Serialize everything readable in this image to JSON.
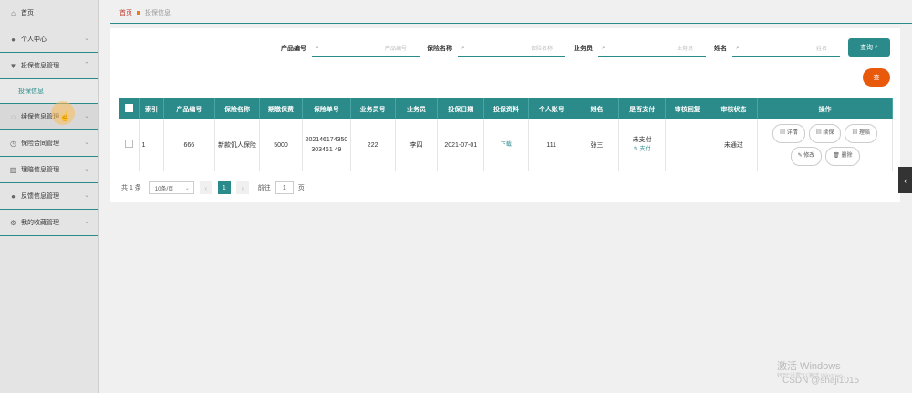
{
  "sidebar": {
    "items": [
      {
        "label": "首页",
        "icon": "home-icon",
        "has_chevron": false
      },
      {
        "label": "个人中心",
        "icon": "user-icon",
        "has_chevron": true
      },
      {
        "label": "投保信息管理",
        "icon": "filter-icon",
        "has_chevron": true,
        "expanded": true
      }
    ],
    "sub_item": "投保信息",
    "items_after": [
      {
        "label": "续保信息管理",
        "icon": "chat-icon",
        "has_chevron": true
      },
      {
        "label": "保险合同管理",
        "icon": "clock-icon",
        "has_chevron": true
      },
      {
        "label": "理赔信息管理",
        "icon": "bank-icon",
        "has_chevron": true
      },
      {
        "label": "反馈信息管理",
        "icon": "user-icon",
        "has_chevron": true
      },
      {
        "label": "我的收藏管理",
        "icon": "gear-icon",
        "has_chevron": true
      }
    ]
  },
  "breadcrumb": {
    "home": "首页",
    "current": "投保信息"
  },
  "search": {
    "product_label": "产品编号",
    "product_placeholder": "产品编号",
    "insurance_label": "保险名称",
    "insurance_placeholder": "保险名称",
    "agent_label": "业务员",
    "agent_placeholder": "业务员",
    "name_label": "姓名",
    "name_placeholder": "姓名",
    "query_button": "查询"
  },
  "add_button": "查",
  "table": {
    "headers": [
      "",
      "索引",
      "产品编号",
      "保险名称",
      "期缴保费",
      "保险单号",
      "业务员号",
      "业务员",
      "投保日期",
      "投保资料",
      "个人账号",
      "姓名",
      "是否支付",
      "审核回复",
      "审核状态",
      "操作"
    ],
    "rows": [
      {
        "index": "1",
        "product_no": "666",
        "insurance_name": "新款饥人保险",
        "premium": "5000",
        "policy_no": "202146174350303461 49",
        "agent_no": "222",
        "agent": "李四",
        "date": "2021-07-01",
        "material": "下载",
        "account": "111",
        "name": "张三",
        "paid": "未支付",
        "pay_link": "支付",
        "reply": "",
        "status": "未通过",
        "actions": [
          "详情",
          "续保",
          "理赔",
          "修改",
          "删除"
        ]
      }
    ]
  },
  "pager": {
    "total": "共 1 条",
    "size": "10条/页",
    "page": "1",
    "goto_prefix": "前往",
    "goto_value": "1",
    "goto_suffix": "页"
  },
  "watermark": {
    "line1": "激活 Windows",
    "line2": "转到\"设置\"以激活 Windows。",
    "credit": "CSDN @shaji1015"
  },
  "colors": {
    "accent": "#2b8a8a",
    "add": "#e8590c"
  }
}
